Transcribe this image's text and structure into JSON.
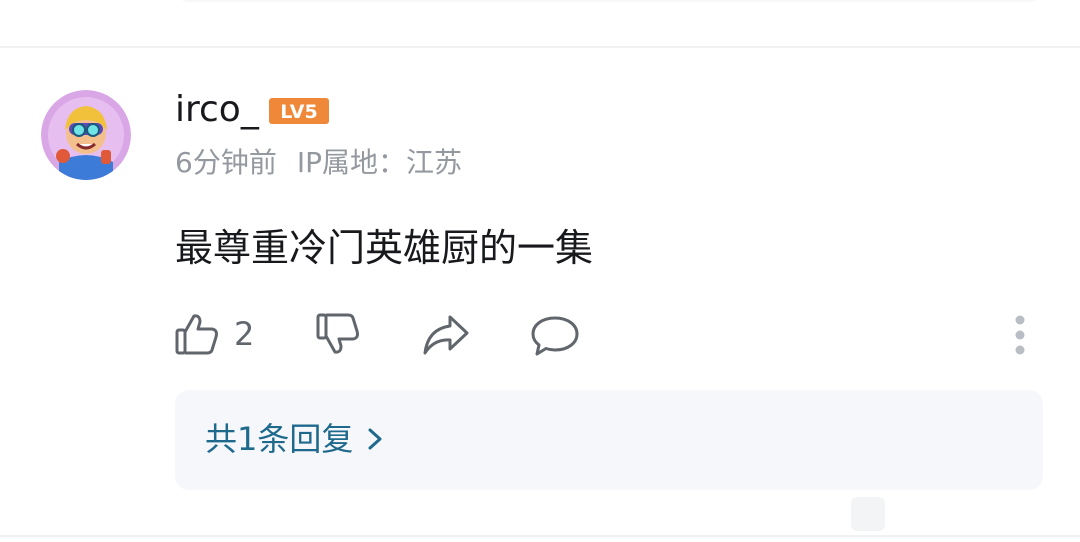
{
  "comment": {
    "username": "irco_",
    "level_badge": "LV5",
    "timestamp": "6分钟前",
    "ip_location": "IP属地：江苏",
    "text": "最尊重冷门英雄厨的一集",
    "like_count": "2",
    "replies_link": "共1条回复"
  },
  "icons": {
    "like": "thumbs-up-icon",
    "dislike": "thumbs-down-icon",
    "share": "share-arrow-icon",
    "reply": "chat-bubble-icon",
    "more": "more-vertical-icon",
    "chevron": "chevron-right-icon"
  },
  "colors": {
    "level_badge": "#f0883a",
    "link": "#1f6a8c",
    "meta_text": "#9499a0",
    "reply_box_bg": "#f6f7fb"
  }
}
